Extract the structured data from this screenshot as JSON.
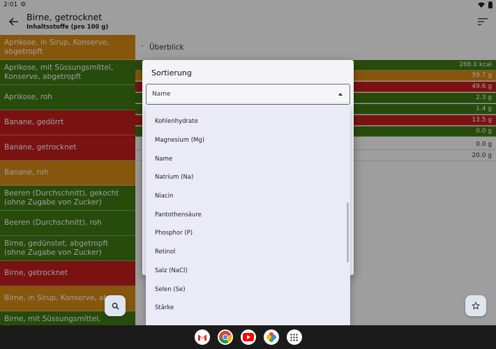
{
  "status": {
    "time": "2:01"
  },
  "appbar": {
    "title": "Birne, getrocknet",
    "subtitle": "Inhaltsstoffe (pro 100 g)"
  },
  "list": [
    {
      "label": "Aprikose, in Sirup, Konserve, abgetropft",
      "color": "orange"
    },
    {
      "label": "Aprikose, mit Süssungsmittel, Konserve, abgetropft",
      "color": "green"
    },
    {
      "label": "Aprikose, roh",
      "color": "green"
    },
    {
      "label": "Banane, gedörrt",
      "color": "red"
    },
    {
      "label": "Banane, getrocknet",
      "color": "red"
    },
    {
      "label": "Banane, roh",
      "color": "orange"
    },
    {
      "label": "Beeren (Durchschnitt), gekocht (ohne Zugabe von Zucker)",
      "color": "green"
    },
    {
      "label": "Beeren (Durchschnitt), roh",
      "color": "green"
    },
    {
      "label": "Birne, gedünstet, abgetropft (ohne Zugabe von Zucker)",
      "color": "green"
    },
    {
      "label": "Birne, getrocknet",
      "color": "red"
    },
    {
      "label": "Birne, in Sirup, Konserve, abge",
      "color": "orange"
    },
    {
      "label": "Birne, mit Süssungsmittel, Konserve,",
      "color": "green"
    }
  ],
  "overview": {
    "label": "Überblick"
  },
  "nutrients": [
    {
      "value": "288.0 kcal",
      "color": "green"
    },
    {
      "value": "59.7 g",
      "color": "orange"
    },
    {
      "value": "49.6 g",
      "color": "red"
    },
    {
      "value": "2.3 g",
      "color": "green"
    },
    {
      "value": "1.4 g",
      "color": "green"
    },
    {
      "value": "13.5 g",
      "color": "red"
    },
    {
      "value": "0.0 g",
      "color": "green"
    },
    {
      "value": "0.0 g",
      "color": "plain"
    },
    {
      "value": "20.0 g",
      "color": "plain"
    }
  ],
  "dialog": {
    "title": "Sortierung",
    "selected": "Name",
    "options": [
      "Kohlenhydrate",
      "Magnesium (Mg)",
      "Name",
      "Natrium (Na)",
      "Niacin",
      "Pantothensäure",
      "Phosphor (P)",
      "Retinol",
      "Salz (NaCl)",
      "Selen (Se)",
      "Stärke"
    ]
  },
  "colors": {
    "orange": "#d98c14",
    "green": "#3f7a13",
    "red": "#c61d1d"
  },
  "icons": [
    "back-arrow-icon",
    "sort-icon",
    "search-icon",
    "star-icon",
    "gmail-icon",
    "chrome-icon",
    "youtube-icon",
    "photos-icon",
    "app-drawer-icon"
  ]
}
